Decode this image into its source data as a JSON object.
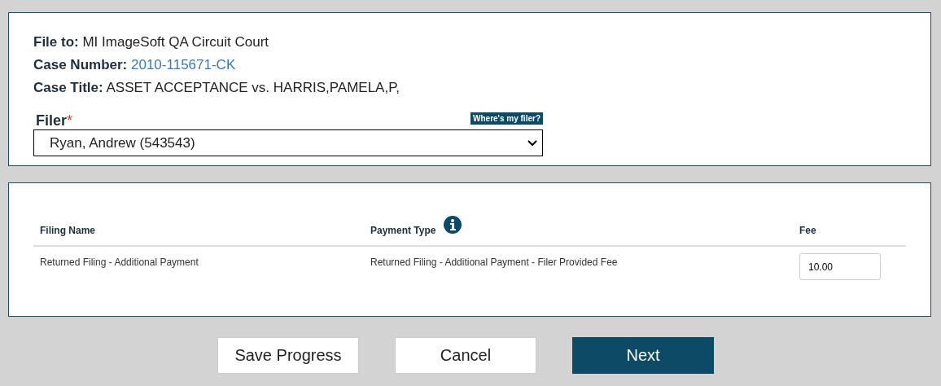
{
  "case_info": [
    {
      "label": "File to:",
      "value": "MI ImageSoft QA Circuit Court",
      "kind": "plain"
    },
    {
      "label": "Case Number:",
      "value": "2010-115671-CK",
      "kind": "link"
    },
    {
      "label": "Case Title:",
      "value": "ASSET ACCEPTANCE vs. HARRIS,PAMELA,P,",
      "kind": "plain"
    }
  ],
  "filer": {
    "label": "Filer",
    "required_mark": "*",
    "help_button": "Where's my filer?",
    "value": "Ryan, Andrew (543543)"
  },
  "table": {
    "columns": [
      {
        "label": "Filing Name",
        "info": false
      },
      {
        "label": "Payment Type",
        "info": true
      },
      {
        "label": "Fee",
        "info": false
      }
    ],
    "rows": [
      {
        "filing_name": "Returned Filing - Additional Payment",
        "payment_type": "Returned Filing - Additional Payment - Filer Provided Fee",
        "fee": "10.00"
      }
    ]
  },
  "buttons": [
    {
      "label": "Save Progress",
      "kind": "secondary"
    },
    {
      "label": "Cancel",
      "kind": "secondary"
    },
    {
      "label": "Next",
      "kind": "primary"
    }
  ]
}
